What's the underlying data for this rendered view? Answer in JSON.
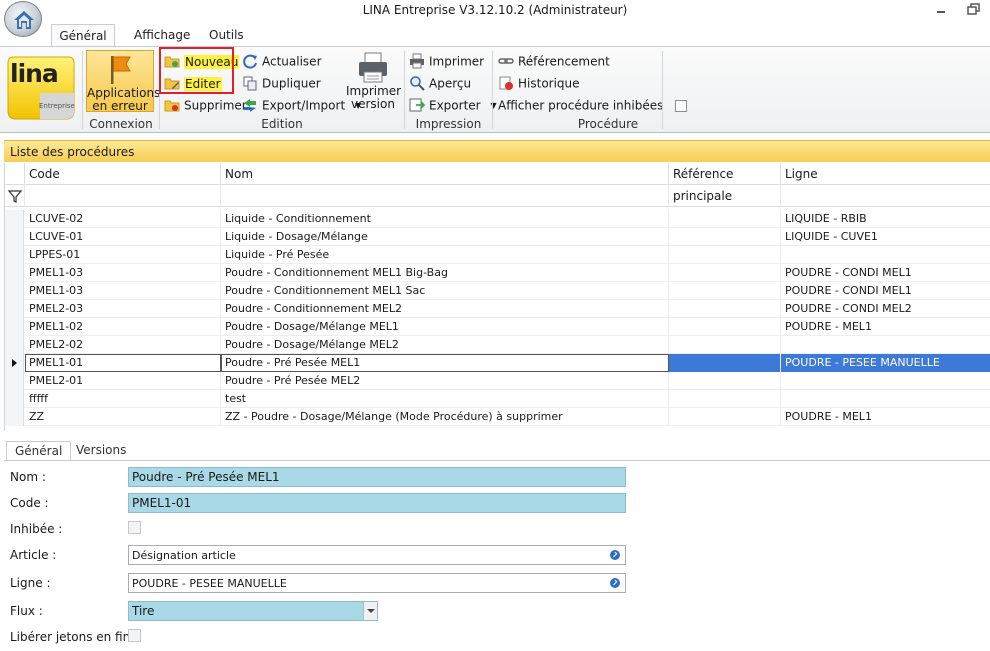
{
  "window": {
    "title": "LINA Entreprise  V3.12.10.2  (Administrateur)",
    "minimize_icon": "minimize-icon",
    "restore_icon": "restore-icon"
  },
  "ribbon_tabs": [
    "Général",
    "Affichage",
    "Outils"
  ],
  "logo": {
    "text": "lina",
    "sub": "Entreprise"
  },
  "groups": {
    "connexion": {
      "label": "Connexion",
      "button": {
        "line1": "Applications",
        "line2": "en erreur"
      }
    },
    "edition": {
      "label": "Edition",
      "col1": [
        "Nouveau",
        "Editer",
        "Supprimer"
      ],
      "col2": [
        "Actualiser",
        "Dupliquer",
        "Export/Import"
      ],
      "print_version": {
        "line1": "Imprimer",
        "line2": "version"
      }
    },
    "impression": {
      "label": "Impression",
      "items": [
        "Imprimer",
        "Aperçu",
        "Exporter"
      ]
    },
    "procedure": {
      "label": "Procédure",
      "items": [
        "Référencement",
        "Historique",
        "Afficher procédure inhibées"
      ]
    }
  },
  "list": {
    "title": "Liste des procédures",
    "columns": [
      "Code",
      "Nom",
      "Référence principale",
      "Ligne"
    ],
    "rows": [
      {
        "code": "LCUVE-02",
        "nom": "Liquide - Conditionnement",
        "ref": "",
        "ligne": "LIQUIDE - RBIB"
      },
      {
        "code": "LCUVE-01",
        "nom": "Liquide - Dosage/Mélange",
        "ref": "",
        "ligne": "LIQUIDE - CUVE1"
      },
      {
        "code": "LPPES-01",
        "nom": "Liquide - Pré Pesée",
        "ref": "",
        "ligne": ""
      },
      {
        "code": "PMEL1-03",
        "nom": "Poudre - Conditionnement MEL1 Big-Bag",
        "ref": "",
        "ligne": "POUDRE - CONDI MEL1"
      },
      {
        "code": "PMEL1-03",
        "nom": "Poudre - Conditionnement MEL1 Sac",
        "ref": "",
        "ligne": "POUDRE - CONDI MEL1"
      },
      {
        "code": "PMEL2-03",
        "nom": "Poudre - Conditionnement MEL2",
        "ref": "",
        "ligne": "POUDRE - CONDI MEL2"
      },
      {
        "code": "PMEL1-02",
        "nom": "Poudre - Dosage/Mélange MEL1",
        "ref": "",
        "ligne": "POUDRE - MEL1"
      },
      {
        "code": "PMEL2-02",
        "nom": "Poudre - Dosage/Mélange MEL2",
        "ref": "",
        "ligne": ""
      },
      {
        "code": "PMEL1-01",
        "nom": "Poudre - Pré Pesée MEL1",
        "ref": "",
        "ligne": "POUDRE - PESEE MANUELLE"
      },
      {
        "code": "PMEL2-01",
        "nom": "Poudre - Pré Pesée MEL2",
        "ref": "",
        "ligne": ""
      },
      {
        "code": "fffff",
        "nom": "test",
        "ref": "",
        "ligne": ""
      },
      {
        "code": "ZZ",
        "nom": "ZZ - Poudre - Dosage/Mélange (Mode Procédure) à supprimer",
        "ref": "",
        "ligne": "POUDRE - MEL1"
      }
    ]
  },
  "detail_tabs": [
    "Général",
    "Versions"
  ],
  "detail": {
    "labels": [
      "Nom :",
      "Code :",
      "Inhibée :",
      "Article :",
      "Ligne :",
      "Flux :",
      "Libérer jetons en fin :"
    ],
    "nom": "Poudre - Pré Pesée MEL1",
    "code": "PMEL1-01",
    "article": "Désignation article",
    "ligne": "POUDRE - PESEE MANUELLE",
    "flux": "Tire"
  },
  "colors": {
    "accent_yellow": "#f7cd52",
    "selection_blue": "#3d79d6",
    "field_blue": "#a9d8e6",
    "highlight_red": "#e0202a"
  }
}
